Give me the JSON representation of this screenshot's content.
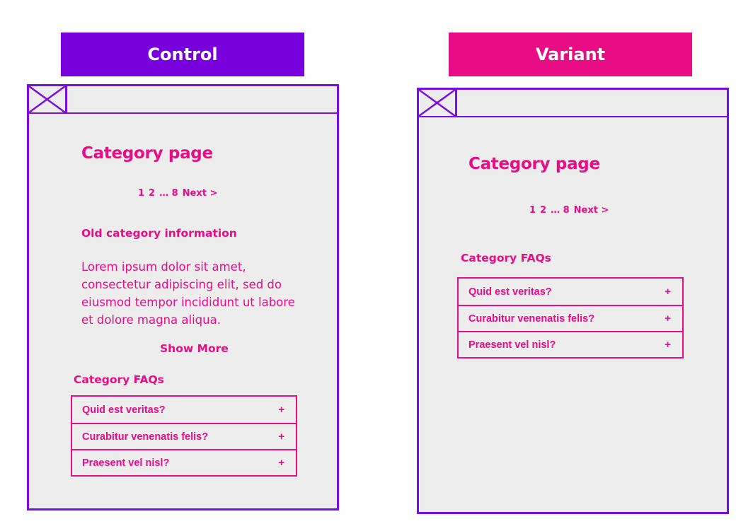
{
  "colors": {
    "control_banner": "#7700dd",
    "variant_banner": "#e80c85",
    "frame_border": "#7a0de0",
    "frame_fill": "#ededed",
    "text_accent": "#e80c85"
  },
  "control": {
    "banner_label": "Control",
    "image_placeholder_icon": "image-placeholder-icon",
    "page_title": "Category page",
    "pagination": [
      "1",
      "2",
      "… 8",
      "Next >"
    ],
    "info_heading": "Old category information",
    "info_text": "Lorem ipsum dolor sit amet, consectetur adipiscing elit, sed do eiusmod tempor incididunt ut labore et dolore magna aliqua.",
    "show_more_label": "Show More",
    "faq_heading": "Category FAQs",
    "faqs": [
      {
        "question": "Quid est veritas?",
        "icon": "+"
      },
      {
        "question": "Curabitur venenatis felis?",
        "icon": "+"
      },
      {
        "question": "Praesent vel nisl?",
        "icon": "+"
      }
    ]
  },
  "variant": {
    "banner_label": "Variant",
    "image_placeholder_icon": "image-placeholder-icon",
    "page_title": "Category page",
    "pagination": [
      "1",
      "2",
      "… 8",
      "Next >"
    ],
    "faq_heading": "Category FAQs",
    "faqs": [
      {
        "question": "Quid est veritas?",
        "icon": "+"
      },
      {
        "question": "Curabitur venenatis felis?",
        "icon": "+"
      },
      {
        "question": "Praesent vel nisl?",
        "icon": "+"
      }
    ]
  }
}
